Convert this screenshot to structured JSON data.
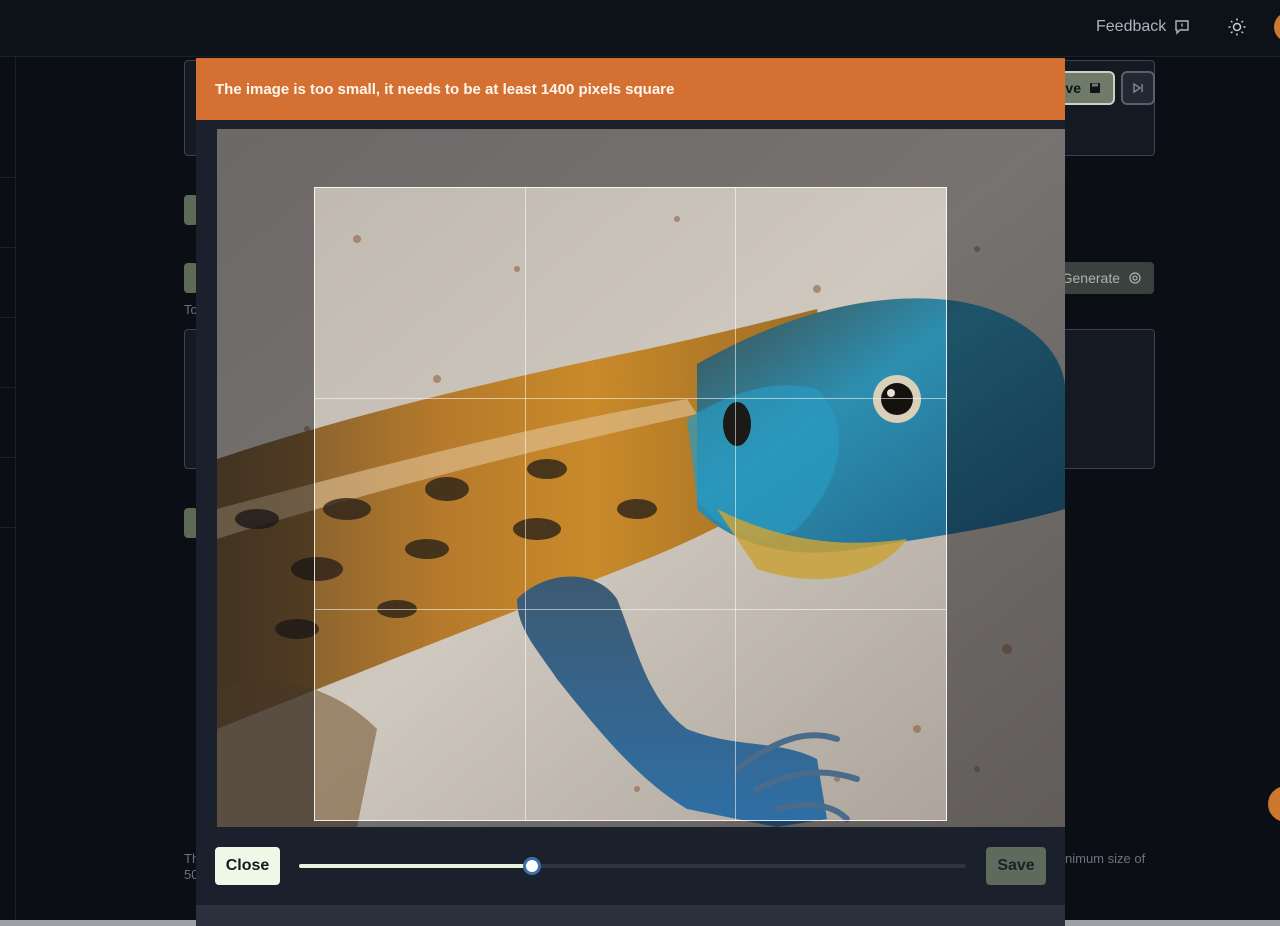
{
  "topbar": {
    "feedback_label": "Feedback",
    "feedback_icon": "message-alert-icon",
    "theme_icon": "sun-icon"
  },
  "background": {
    "save_label": "ve",
    "generate_label": "Generate",
    "text_fragment_1": "To",
    "text_fragment_2": "Th",
    "text_fragment_3": "50",
    "text_fragment_4": "nimum size of"
  },
  "modal": {
    "alert_message": "The image is too small, it needs to be at least 1400 pixels square",
    "alert_color": "#d47132",
    "close_label": "Close",
    "save_label": "Save",
    "zoom_fraction": 0.35
  }
}
